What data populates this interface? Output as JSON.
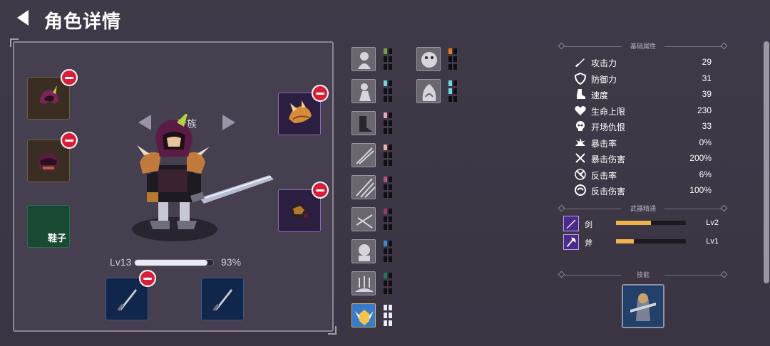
{
  "header": {
    "title": "角色详情"
  },
  "character": {
    "race": "蛮族",
    "level_text": "Lv13",
    "xp_percent_text": "93%",
    "xp_fraction": 0.93,
    "shoes_label": "鞋子"
  },
  "skills_list": [
    {
      "icon": "beast-skill-icon",
      "pips": [
        "#6ea53a",
        "#101014",
        "#101014",
        "#101014",
        "#101014",
        "#101014"
      ]
    },
    {
      "icon": "warrior-pose-skill-icon",
      "pips": [
        "#6dd6e0",
        "#101014",
        "#101014",
        "#101014",
        "#101014",
        "#101014"
      ]
    },
    {
      "icon": "boot-skill-icon",
      "pips": [
        "#e6a4c6",
        "#101014",
        "#101014",
        "#101014",
        "#101014",
        "#101014"
      ]
    },
    {
      "icon": "crossed-blades-skill-icon",
      "pips": [
        "#e9b3a6",
        "#101014",
        "#101014",
        "#101014",
        "#101014",
        "#101014"
      ]
    },
    {
      "icon": "slash-skill-icon",
      "pips": [
        "#c04e86",
        "#101014",
        "#101014",
        "#101014",
        "#101014",
        "#101014"
      ]
    },
    {
      "icon": "sword-fan-skill-icon",
      "pips": [
        "#9a3a6a",
        "#101014",
        "#101014",
        "#101014",
        "#101014",
        "#101014"
      ]
    },
    {
      "icon": "armored-guard-skill-icon",
      "pips": [
        "#3a8ad8",
        "#101014",
        "#101014",
        "#101014",
        "#101014",
        "#101014"
      ]
    },
    {
      "icon": "fire-ground-skill-icon",
      "pips": [
        "#1f7a5a",
        "#101014",
        "#101014",
        "#101014",
        "#101014",
        "#101014"
      ]
    },
    {
      "icon": "winged-shield-skill-icon",
      "pips": [
        "#e8eaf4",
        "#e8eaf4",
        "#e8eaf4",
        "#e8eaf4",
        "#e8eaf4",
        "#e8eaf4"
      ]
    },
    {
      "icon": "demon-face-skill-icon",
      "pips": [
        "#e07a2a",
        "#101014",
        "#101014",
        "#101014",
        "#101014",
        "#101014"
      ]
    },
    {
      "icon": "hooded-figure-skill-icon",
      "pips": [
        "#6dd6e0",
        "#101014",
        "#6dd6e0",
        "#101014",
        "#101014",
        "#101014"
      ]
    }
  ],
  "sections": {
    "basic": "基础属性",
    "weapon": "武器精通",
    "skill": "技能"
  },
  "stats": [
    {
      "icon": "sword-icon",
      "name": "攻击力",
      "value": "29"
    },
    {
      "icon": "shield-icon",
      "name": "防御力",
      "value": "31"
    },
    {
      "icon": "boot-icon",
      "name": "速度",
      "value": "39"
    },
    {
      "icon": "heart-icon",
      "name": "生命上限",
      "value": "230"
    },
    {
      "icon": "skull-icon",
      "name": "开场仇恨",
      "value": "33"
    },
    {
      "icon": "burst-icon",
      "name": "暴击率",
      "value": "0%"
    },
    {
      "icon": "crossed-swords-icon",
      "name": "暴击伤害",
      "value": "200%"
    },
    {
      "icon": "counter-icon",
      "name": "反击率",
      "value": "6%"
    },
    {
      "icon": "swirl-icon",
      "name": "反击伤害",
      "value": "100%"
    }
  ],
  "mastery": [
    {
      "icon": "sword-mastery-icon",
      "name": "剑",
      "level": "Lv2",
      "fraction": 0.5
    },
    {
      "icon": "axe-mastery-icon",
      "name": "斧",
      "level": "Lv1",
      "fraction": 0.25
    }
  ],
  "colors": {
    "accent": "#f0b24c",
    "remove": "#d81f3a",
    "panel_bg": "#463f50"
  }
}
